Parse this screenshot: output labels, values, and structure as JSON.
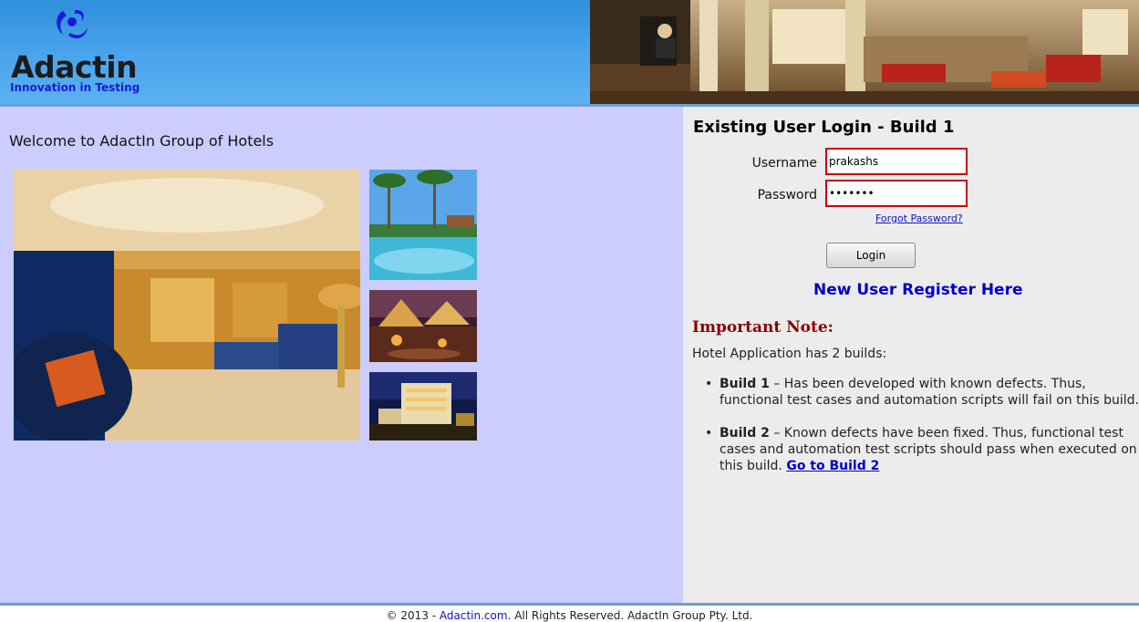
{
  "header": {
    "logo_name": "Adactin",
    "logo_tagline": "Innovation in Testing"
  },
  "left": {
    "welcome": "Welcome to AdactIn Group of Hotels"
  },
  "login": {
    "title": "Existing User Login - Build 1",
    "username_label": "Username",
    "username_value": "prakashs",
    "password_label": "Password",
    "password_value": "prakash",
    "forgot_password": "Forgot Password?",
    "login_button": "Login",
    "register_link": "New User Register Here"
  },
  "note": {
    "title": "Important Note:",
    "intro": "Hotel Application has 2 builds:",
    "build1_label": "Build 1",
    "build1_text": " – Has been developed with known defects. Thus, functional test cases and automation scripts will fail on this build.",
    "build2_label": "Build 2",
    "build2_text": " – Known defects have been fixed. Thus, functional test cases and automation test scripts should pass when executed on this build. ",
    "build2_link": "Go to Build 2"
  },
  "footer": {
    "prefix": "© 2013 - ",
    "link": "Adactin.com",
    "suffix": ". All Rights Reserved. AdactIn Group Pty. Ltd."
  },
  "colors": {
    "header_blue": "#4aa5ec",
    "left_panel": "#cccdfc",
    "right_panel": "#ececec",
    "error_border": "#cc0000",
    "link_blue": "#0000cc",
    "note_title": "#8b0000"
  }
}
